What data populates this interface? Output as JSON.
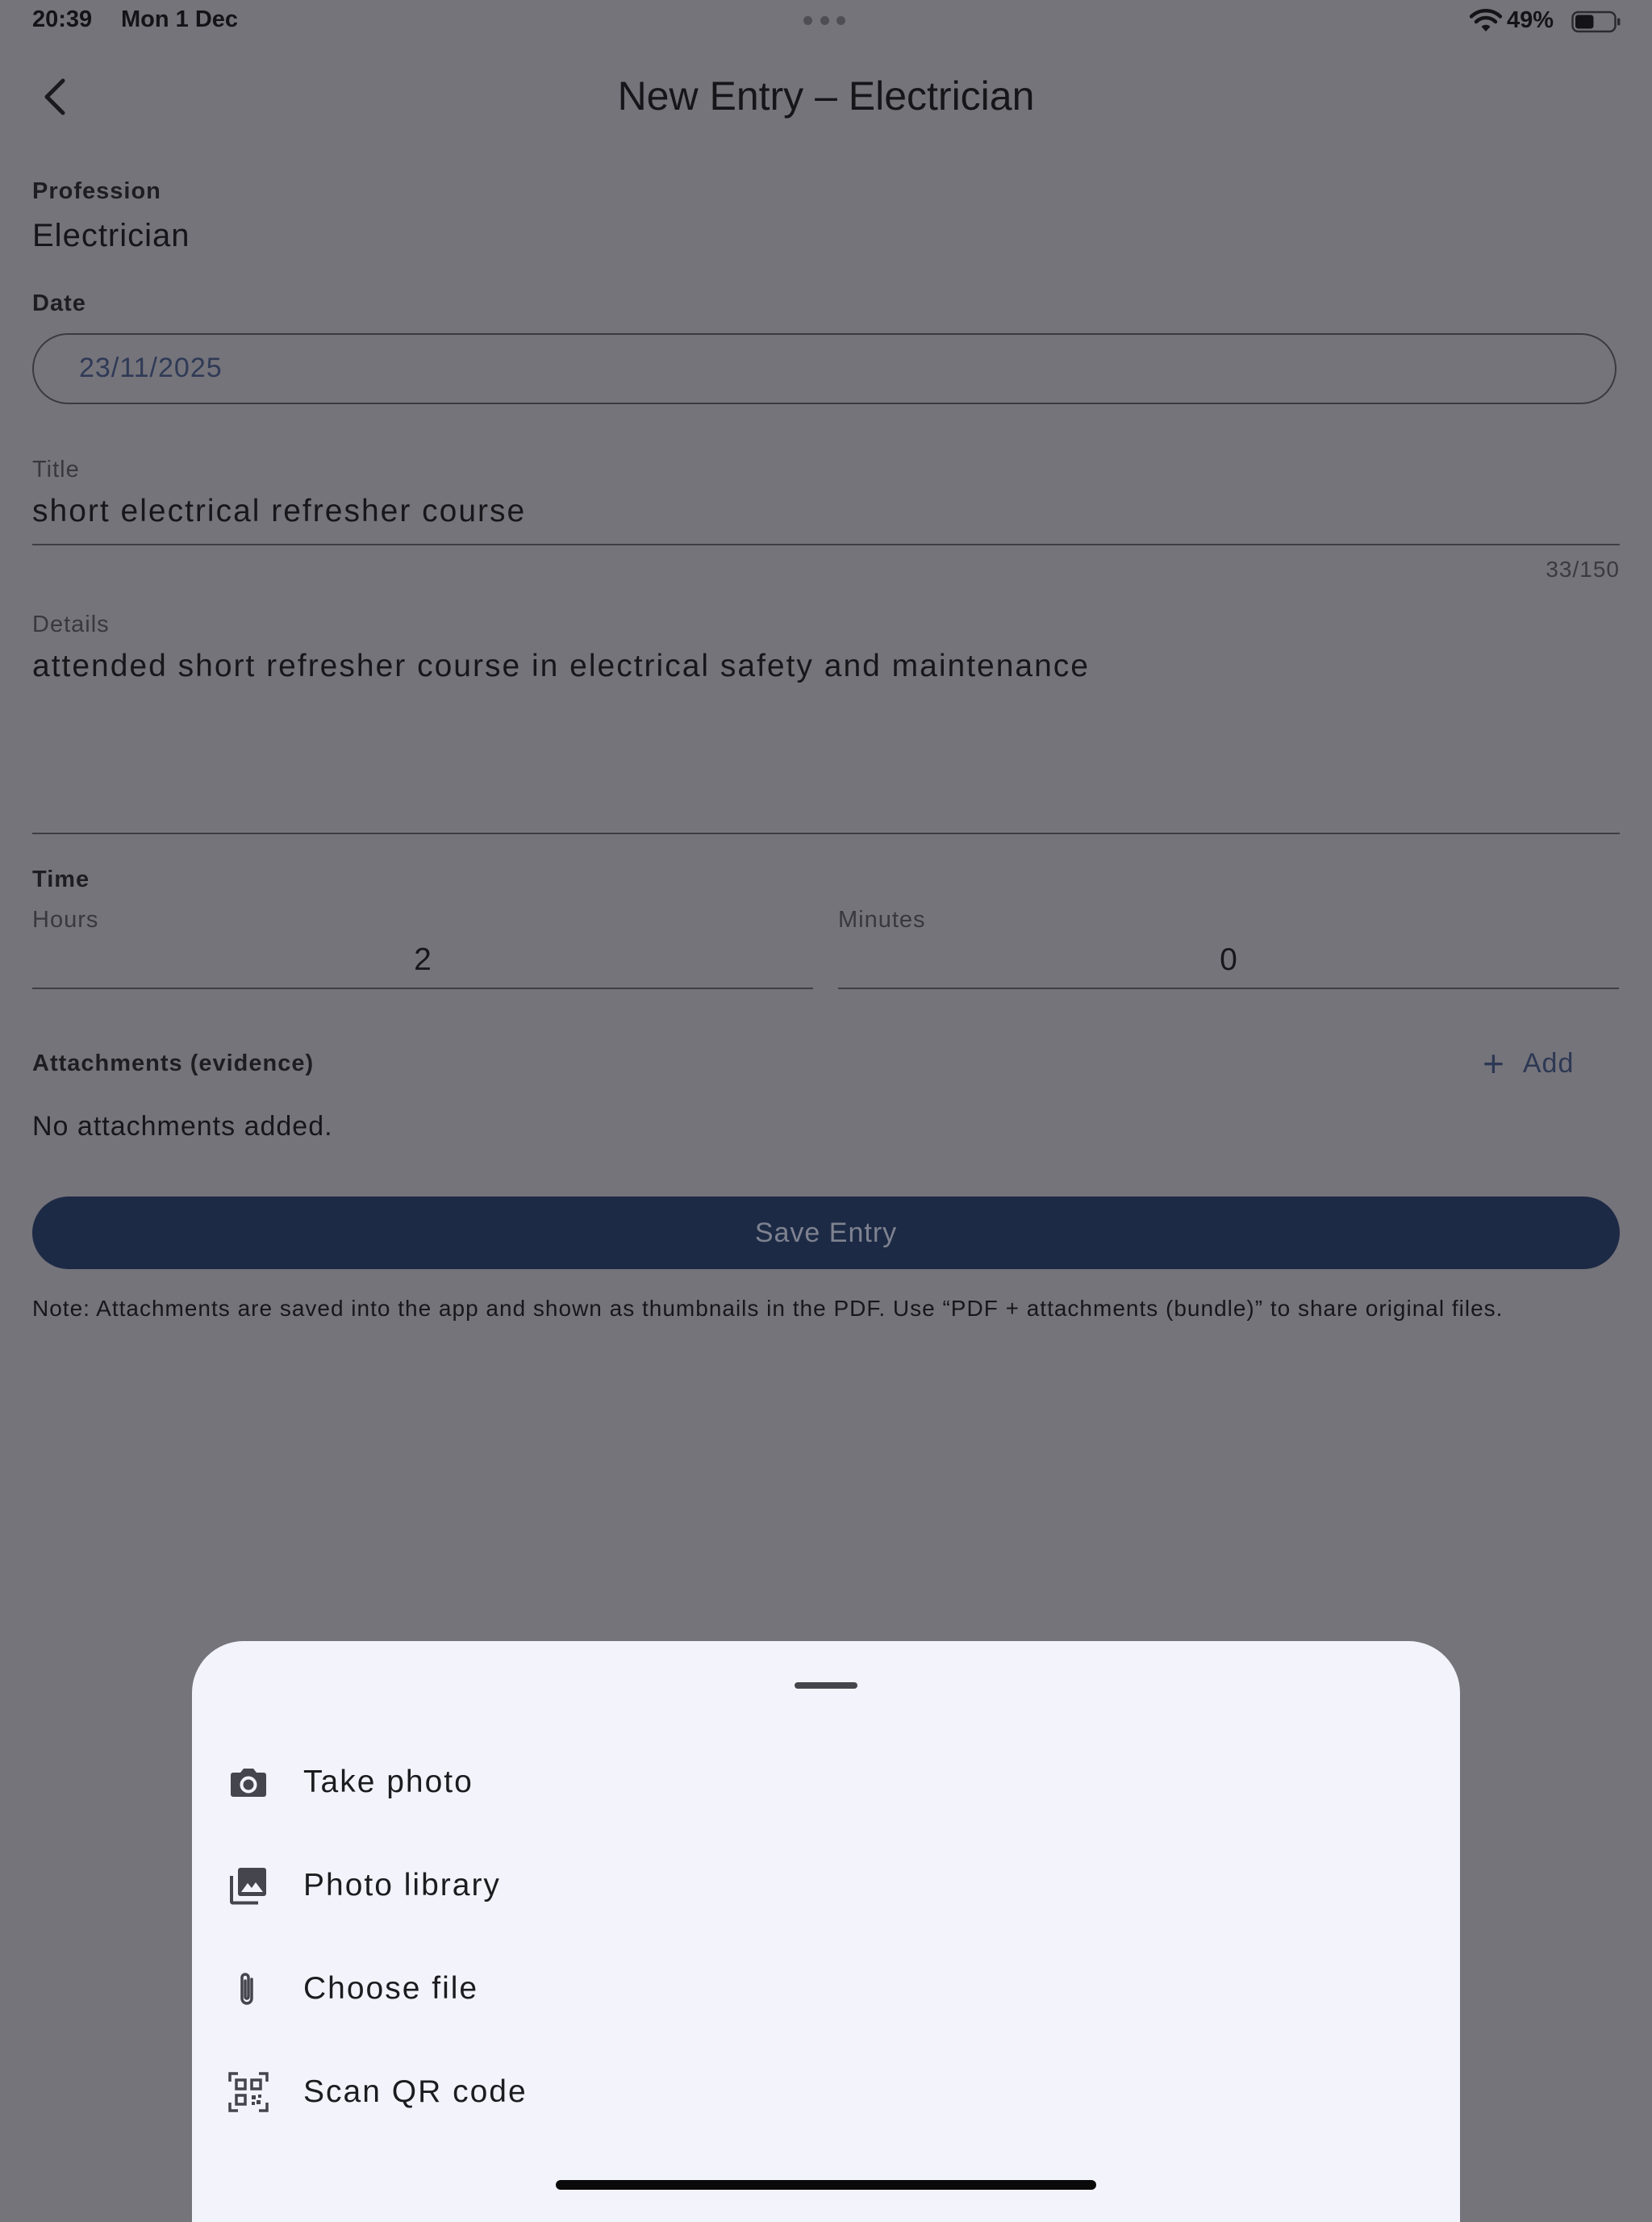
{
  "status_bar": {
    "time": "20:39",
    "date": "Mon 1 Dec",
    "battery_percent": "49%",
    "battery_level": 0.49
  },
  "header": {
    "back_icon": "chevron-left-icon",
    "title": "New Entry – Electrician"
  },
  "form": {
    "profession_label": "Profession",
    "profession_value": "Electrician",
    "date_label": "Date",
    "date_value": "23/11/2025",
    "title_label": "Title",
    "title_value": "short electrical refresher course",
    "title_counter": "33/150",
    "details_label": "Details",
    "details_value": "attended short refresher course in electrical safety and maintenance",
    "time_label": "Time",
    "hours_label": "Hours",
    "hours_value": "2",
    "minutes_label": "Minutes",
    "minutes_value": "0",
    "attachments_label": "Attachments (evidence)",
    "add_label": "Add",
    "no_attachments": "No attachments added.",
    "save_label": "Save Entry",
    "note": "Note: Attachments are saved into the app and shown as thumbnails in the PDF. Use “PDF + attachments (bundle)” to share original files."
  },
  "sheet": {
    "items": [
      {
        "label": "Take photo",
        "icon": "camera-icon"
      },
      {
        "label": "Photo library",
        "icon": "photo-library-icon"
      },
      {
        "label": "Choose file",
        "icon": "paperclip-icon"
      },
      {
        "label": "Scan QR code",
        "icon": "qr-code-icon"
      }
    ]
  },
  "colors": {
    "scrim": "#75747b",
    "primary": "#1d2a45",
    "sheet": "#f3f4fb"
  }
}
